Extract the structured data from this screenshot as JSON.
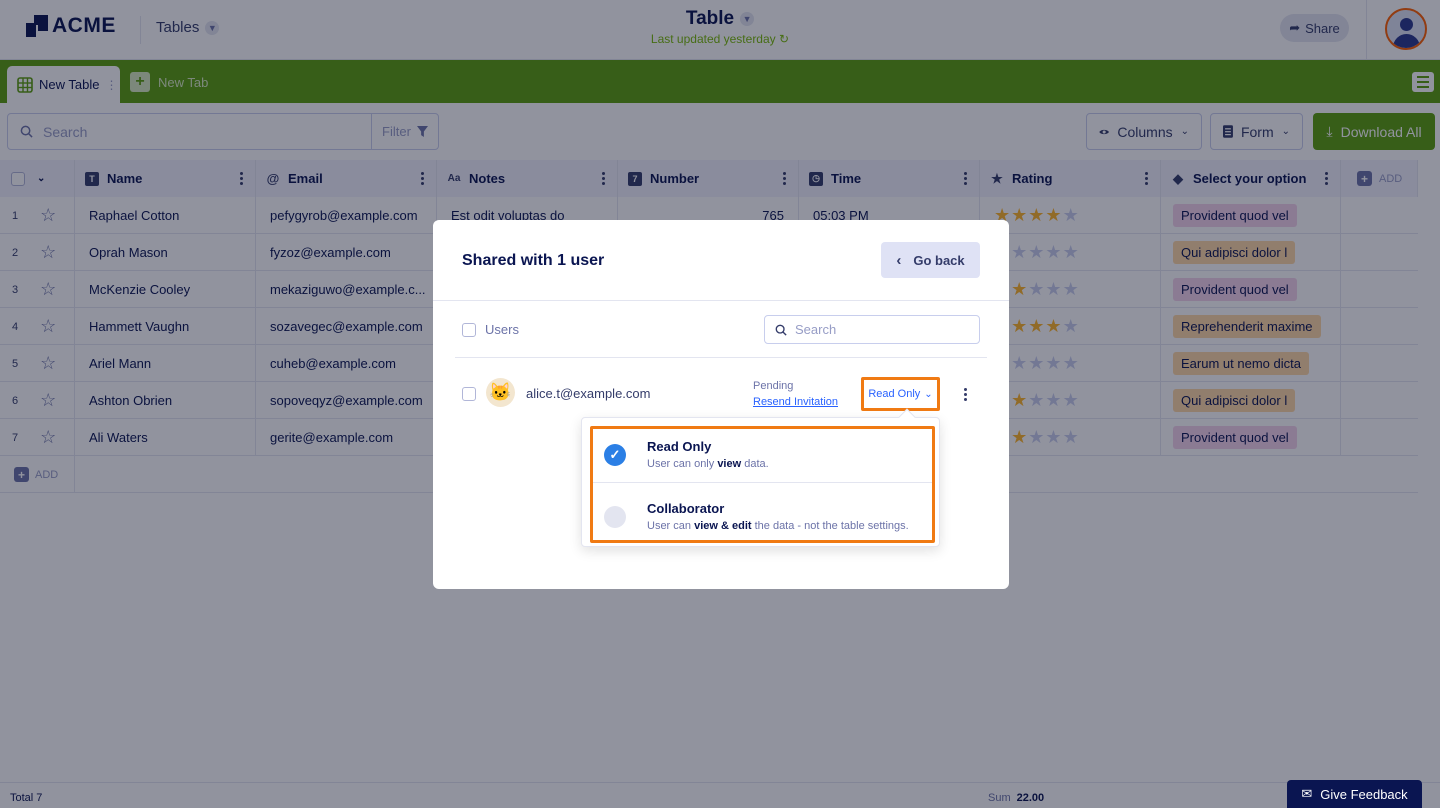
{
  "app": {
    "logo_text": "ACME",
    "tables_menu": "Tables",
    "title": "Table",
    "subtitle": "Last updated yesterday",
    "share_label": "Share"
  },
  "tabs": {
    "active_label": "New Table",
    "new_tab_label": "New Tab"
  },
  "toolbar": {
    "search_placeholder": "Search",
    "filter_label": "Filter",
    "columns_label": "Columns",
    "form_label": "Form",
    "download_label": "Download All"
  },
  "table": {
    "columns": [
      {
        "label": "Name",
        "icon": "T"
      },
      {
        "label": "Email",
        "icon": "@"
      },
      {
        "label": "Notes",
        "icon": "Aa"
      },
      {
        "label": "Number",
        "icon": "7"
      },
      {
        "label": "Time",
        "icon": "clock"
      },
      {
        "label": "Rating",
        "icon": "star"
      },
      {
        "label": "Select your option",
        "icon": "tag"
      }
    ],
    "add_column_label": "ADD",
    "add_row_label": "ADD",
    "rows": [
      {
        "num": "1",
        "name": "Raphael Cotton",
        "email": "pefygyrob@example.com",
        "notes": "Est odit voluptas do",
        "number": "765",
        "time": "05:03 PM",
        "rating": 4,
        "option": "Provident quod vel",
        "option_color": "#f5d3ec"
      },
      {
        "num": "2",
        "name": "Oprah Mason",
        "email": "fyzoz@example.com",
        "notes": "",
        "number": "",
        "time": "",
        "rating": 1,
        "option": "Qui adipisci dolor l",
        "option_color": "#ffd9a6"
      },
      {
        "num": "3",
        "name": "McKenzie Cooley",
        "email": "mekaziguwo@example.c...",
        "notes": "",
        "number": "",
        "time": "",
        "rating": 2,
        "option": "Provident quod vel",
        "option_color": "#f5d3ec"
      },
      {
        "num": "4",
        "name": "Hammett Vaughn",
        "email": "sozavegec@example.com",
        "notes": "",
        "number": "",
        "time": "",
        "rating": 4,
        "option": "Reprehenderit maxime",
        "option_color": "#ffd9a6"
      },
      {
        "num": "5",
        "name": "Ariel Mann",
        "email": "cuheb@example.com",
        "notes": "",
        "number": "",
        "time": "",
        "rating": 1,
        "option": "Earum ut nemo dicta",
        "option_color": "#ffd9a6"
      },
      {
        "num": "6",
        "name": "Ashton Obrien",
        "email": "sopoveqyz@example.com",
        "notes": "",
        "number": "",
        "time": "",
        "rating": 2,
        "option": "Qui adipisci dolor l",
        "option_color": "#ffd9a6"
      },
      {
        "num": "7",
        "name": "Ali Waters",
        "email": "gerite@example.com",
        "notes": "",
        "number": "",
        "time": "",
        "rating": 2,
        "option": "Provident quod vel",
        "option_color": "#f5d3ec"
      }
    ]
  },
  "footer": {
    "total": "Total 7",
    "sum_label": "Sum",
    "sum_value": "22.00",
    "feedback_label": "Give Feedback"
  },
  "modal": {
    "title": "Shared with 1 user",
    "go_back_label": "Go back",
    "users_label": "Users",
    "search_placeholder": "Search",
    "user": {
      "email": "alice.t@example.com",
      "status": "Pending",
      "resend_label": "Resend Invitation",
      "role": "Read Only"
    },
    "role_options": [
      {
        "name": "Read Only",
        "desc_pre": "User can only ",
        "desc_bold": "view",
        "desc_post": " data.",
        "selected": true
      },
      {
        "name": "Collaborator",
        "desc_pre": "User can ",
        "desc_bold": "view & edit",
        "desc_post": " the data - not the table settings.",
        "selected": false
      }
    ]
  },
  "colors": {
    "brand_green": "#5c9e0c",
    "navy": "#0a1551",
    "highlight_orange": "#f07a13",
    "link_blue": "#2962ff",
    "star_gold": "#ffb629"
  }
}
